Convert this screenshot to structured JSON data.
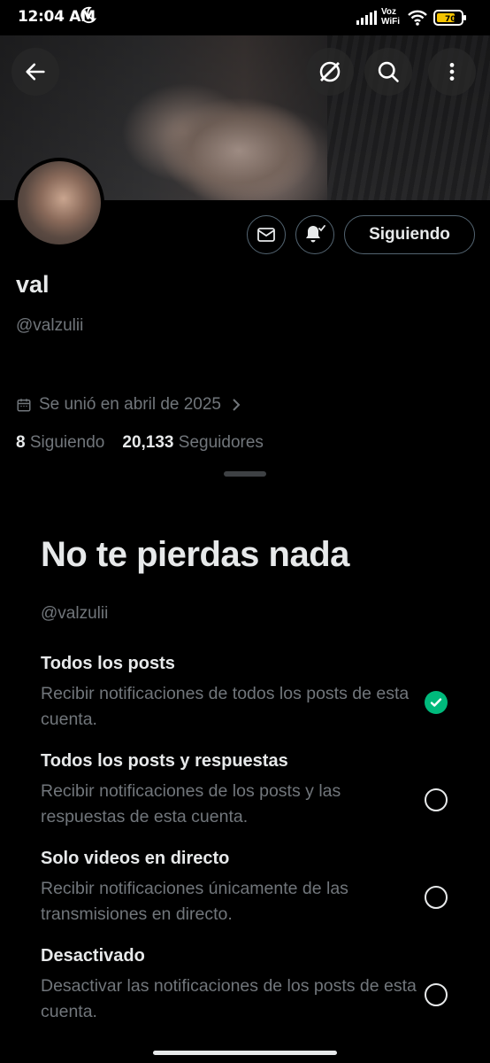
{
  "status_bar": {
    "time": "12:04 AM",
    "network_label_top": "Voz",
    "network_label_bottom": "WiFi",
    "battery_level": "70"
  },
  "header": {
    "back_icon": "arrow-left-icon",
    "grok_icon": "grok-icon",
    "search_icon": "search-icon",
    "more_icon": "more-vertical-icon"
  },
  "profile": {
    "display_name": "val",
    "handle": "@valzulii",
    "joined": "Se unió en abril de 2025",
    "following_count": "8",
    "following_label": "Siguiendo",
    "followers_count": "20,133",
    "followers_label": "Seguidores",
    "following_button": "Siguiendo"
  },
  "sheet": {
    "title": "No te pierdas nada",
    "handle": "@valzulii",
    "options": [
      {
        "title": "Todos los posts",
        "desc": "Recibir notificaciones de todos los posts de esta cuenta.",
        "selected": true
      },
      {
        "title": "Todos los posts y respuestas",
        "desc": "Recibir notificaciones de los posts y las respuestas de esta cuenta.",
        "selected": false
      },
      {
        "title": "Solo videos en directo",
        "desc": "Recibir notificaciones únicamente de las transmisiones en directo.",
        "selected": false
      },
      {
        "title": "Desactivado",
        "desc": "Desactivar las notificaciones de los posts de esta cuenta.",
        "selected": false
      }
    ]
  },
  "colors": {
    "background": "#000000",
    "text_primary": "#e7e9ea",
    "text_secondary": "#71767b",
    "check_green": "#00ba7c"
  }
}
